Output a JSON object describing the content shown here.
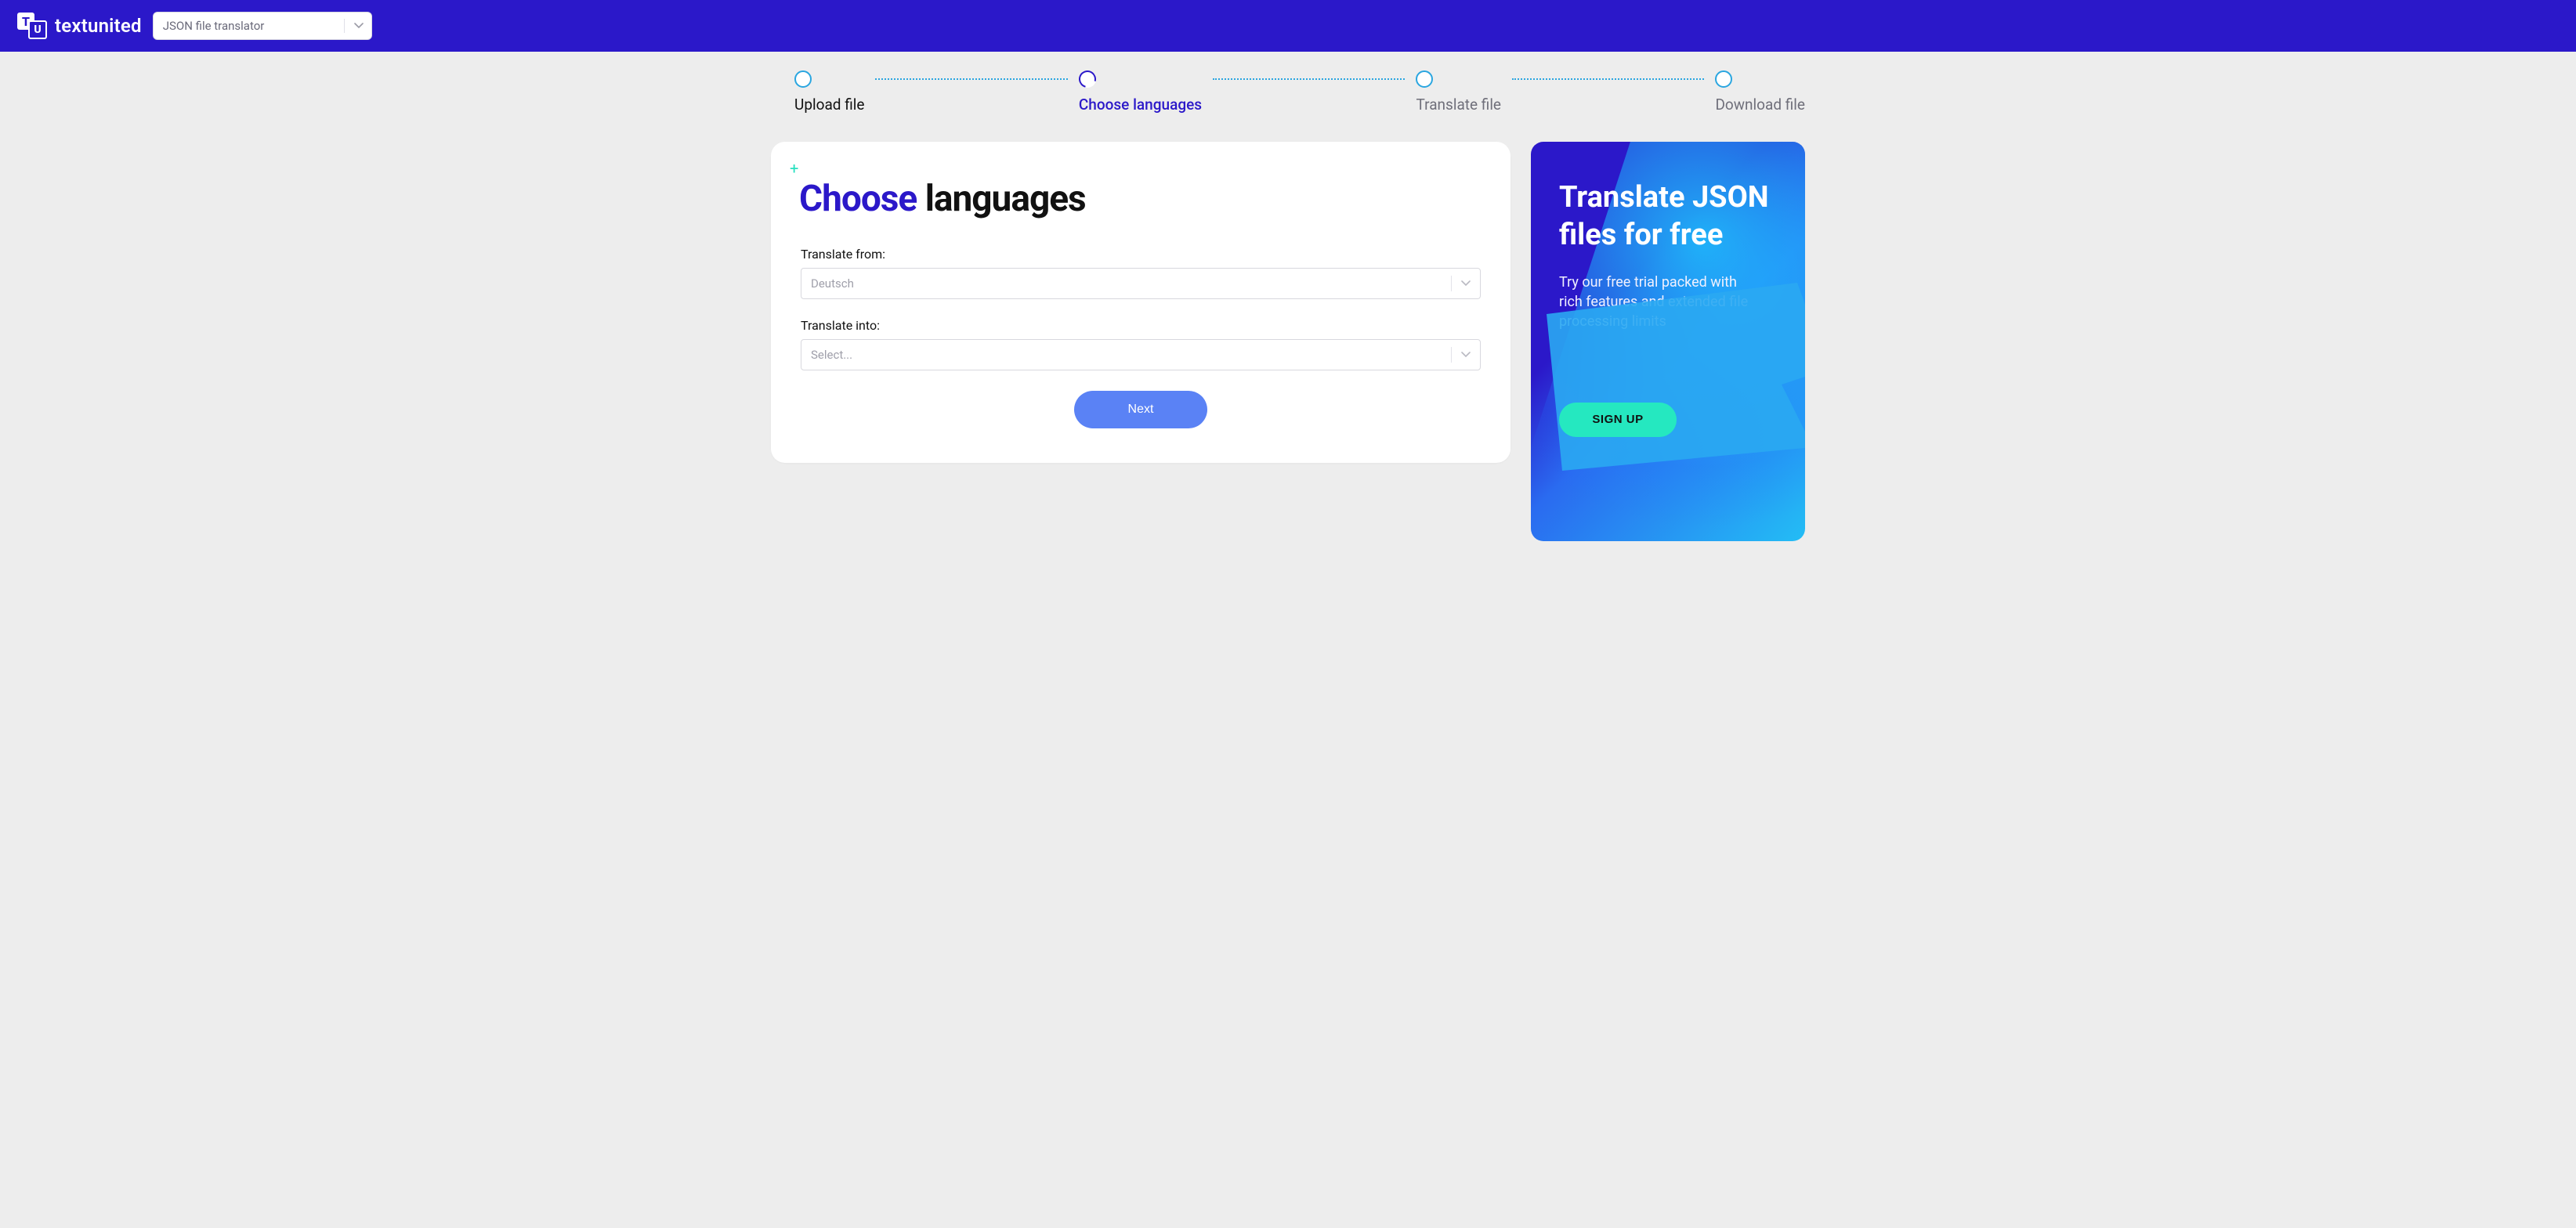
{
  "header": {
    "brand": "textunited",
    "translator_select_value": "JSON file translator"
  },
  "steps": [
    {
      "label": "Upload file",
      "state": "done"
    },
    {
      "label": "Choose languages",
      "state": "active"
    },
    {
      "label": "Translate file",
      "state": "future"
    },
    {
      "label": "Download file",
      "state": "future"
    }
  ],
  "main": {
    "title_accent": "Choose",
    "title_rest": "languages",
    "from_label": "Translate from:",
    "from_value": "Deutsch",
    "into_label": "Translate into:",
    "into_placeholder": "Select...",
    "next_label": "Next"
  },
  "promo": {
    "heading": "Translate JSON files for free",
    "body": "Try our free trial packed with rich features and extended file processing limits",
    "cta": "SIGN UP"
  }
}
